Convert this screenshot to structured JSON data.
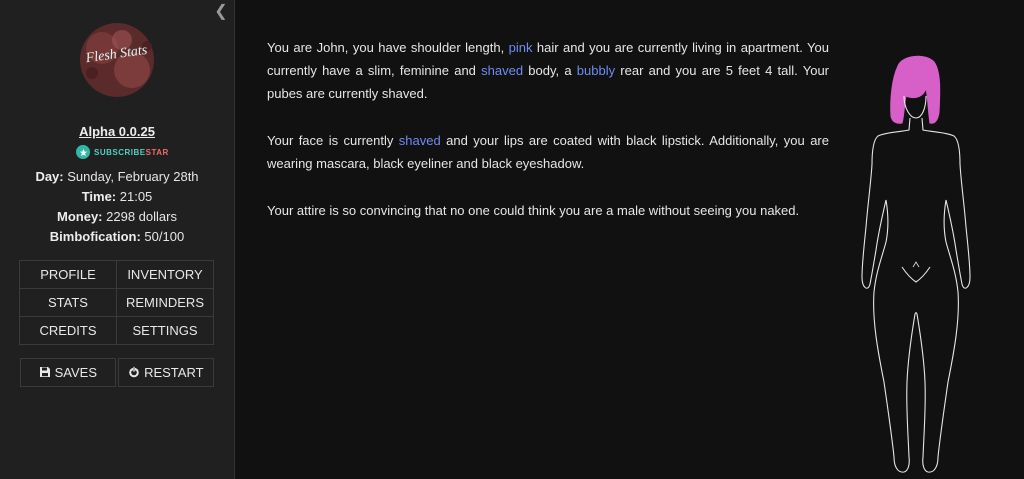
{
  "logo": {
    "text": "Flesh Stats",
    "icon": "logo-pink-splatter"
  },
  "version": "Alpha 0.0.25",
  "subscribestar": {
    "label_a": "SUBSCRIBE",
    "label_b": "STAR",
    "icon": "subscribestar-icon"
  },
  "stats": [
    {
      "label": "Day:",
      "value": "Sunday, February 28th"
    },
    {
      "label": "Time:",
      "value": "21:05"
    },
    {
      "label": "Money:",
      "value": "2298 dollars"
    },
    {
      "label": "Bimbofication:",
      "value": "50/100"
    }
  ],
  "menu": [
    "PROFILE",
    "INVENTORY",
    "STATS",
    "REMINDERS",
    "CREDITS",
    "SETTINGS"
  ],
  "saves_label": "SAVES",
  "restart_label": "RESTART",
  "story": {
    "p1": [
      {
        "t": "You are John, you have shoulder length, "
      },
      {
        "t": "pink",
        "hl": true
      },
      {
        "t": " hair and you are currently living in apartment. You currently have a slim, feminine and "
      },
      {
        "t": "shaved",
        "hl": true
      },
      {
        "t": " body, a "
      },
      {
        "t": "bubbly",
        "hl": true
      },
      {
        "t": " rear and you are 5 feet 4 tall. Your pubes are currently shaved."
      }
    ],
    "p2": [
      {
        "t": "Your face is currently "
      },
      {
        "t": "shaved",
        "hl": true
      },
      {
        "t": " and your lips are coated with black lipstick. Additionally, you are wearing mascara, black eyeliner and black eyeshadow."
      }
    ],
    "p3": "Your attire is so convincing that no one could think you are a male without seeing you naked."
  },
  "colors": {
    "highlight": "#6f8cf0",
    "hair": "#d65fc8",
    "logo_bg": "#5b2a2a"
  }
}
